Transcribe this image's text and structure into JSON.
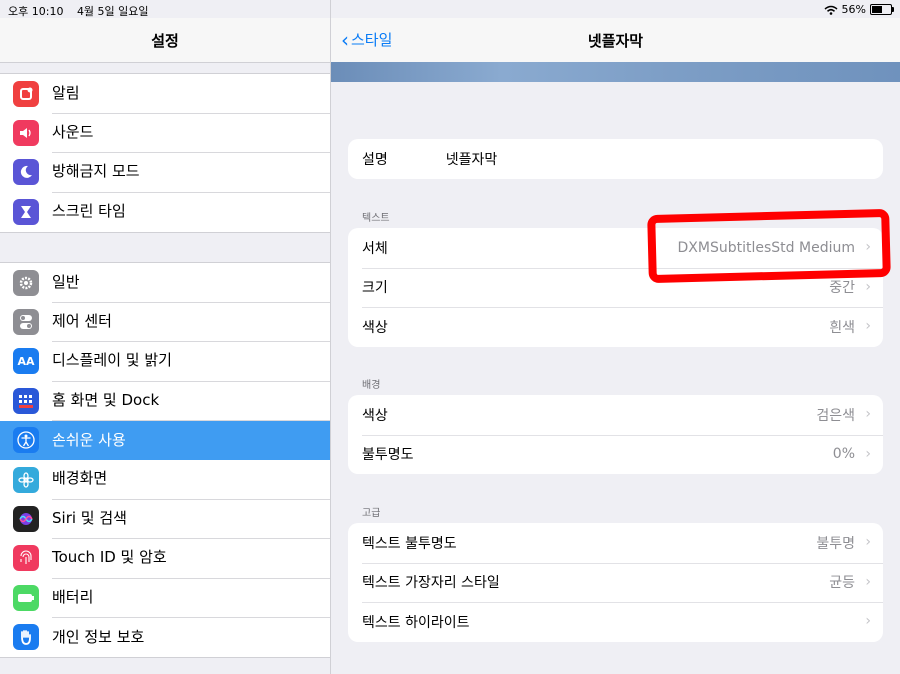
{
  "status_bar": {
    "time": "오후 10:10",
    "date": "4월 5일 일요일",
    "battery": "56%"
  },
  "sidebar": {
    "title": "설정",
    "group1": [
      {
        "label": "알림",
        "icon": "notifications-icon",
        "color": "#f04040"
      },
      {
        "label": "사운드",
        "icon": "sound-icon",
        "color": "#f03a5f"
      },
      {
        "label": "방해금지 모드",
        "icon": "moon-icon",
        "color": "#5a55d6"
      },
      {
        "label": "스크린 타임",
        "icon": "hourglass-icon",
        "color": "#5a55d6"
      }
    ],
    "group2": [
      {
        "label": "일반",
        "icon": "gear-icon",
        "color": "#8e8e93"
      },
      {
        "label": "제어 센터",
        "icon": "toggles-icon",
        "color": "#8e8e93"
      },
      {
        "label": "디스플레이 및 밝기",
        "icon": "display-icon",
        "color": "#1a7cf0"
      },
      {
        "label": "홈 화면 및 Dock",
        "icon": "home-screen-icon",
        "color": "#2a58d8"
      },
      {
        "label": "손쉬운 사용",
        "icon": "accessibility-icon",
        "color": "#1a7cf0",
        "selected": true
      },
      {
        "label": "배경화면",
        "icon": "wallpaper-icon",
        "color": "#34aadc"
      },
      {
        "label": "Siri 및 검색",
        "icon": "siri-icon",
        "color": "#222"
      },
      {
        "label": "Touch ID 및 암호",
        "icon": "fingerprint-icon",
        "color": "#f03a5f"
      },
      {
        "label": "배터리",
        "icon": "battery-icon",
        "color": "#4cd964"
      },
      {
        "label": "개인 정보 보호",
        "icon": "hand-icon",
        "color": "#1a7cf0"
      }
    ]
  },
  "detail": {
    "back_label": "스타일",
    "title": "넷플자막",
    "description": {
      "label": "설명",
      "value": "넷플자막"
    },
    "text_section": {
      "header": "텍스트",
      "rows": [
        {
          "label": "서체",
          "value": "DXMSubtitlesStd Medium"
        },
        {
          "label": "크기",
          "value": "중간"
        },
        {
          "label": "색상",
          "value": "흰색"
        }
      ]
    },
    "background_section": {
      "header": "배경",
      "rows": [
        {
          "label": "색상",
          "value": "검은색"
        },
        {
          "label": "불투명도",
          "value": "0%"
        }
      ]
    },
    "advanced_section": {
      "header": "고급",
      "rows": [
        {
          "label": "텍스트 불투명도",
          "value": "불투명"
        },
        {
          "label": "텍스트 가장자리 스타일",
          "value": "균등"
        },
        {
          "label": "텍스트 하이라이트",
          "value": ""
        }
      ]
    }
  }
}
